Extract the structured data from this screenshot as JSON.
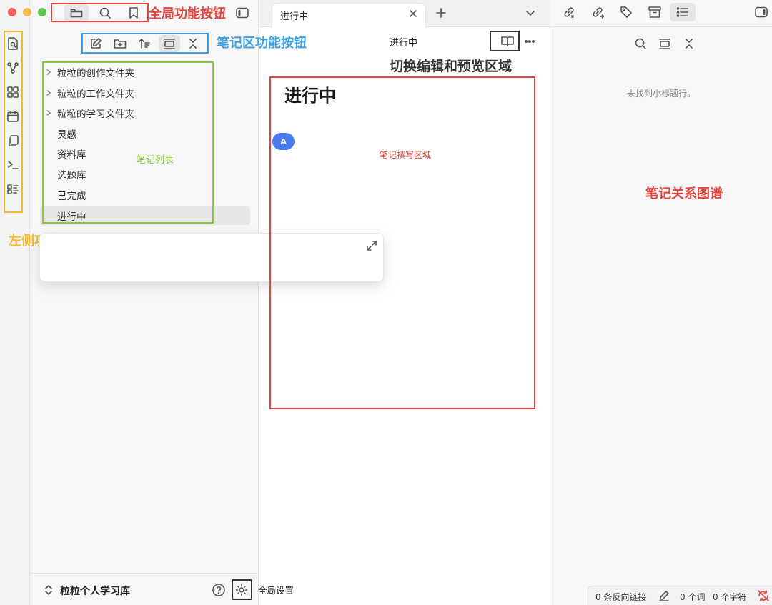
{
  "colors": {
    "annotation_red": "#e0463f",
    "annotation_blue": "#3fa1e8",
    "annotation_green": "#8cc63f",
    "annotation_yellow": "#f3b929",
    "annotation_black": "#333333",
    "avatar_blue": "#4a7cf0"
  },
  "window": {
    "traffic_lights": [
      "close",
      "minimize",
      "zoom"
    ]
  },
  "global_toolbar": {
    "icons": [
      "folder-icon",
      "search-icon",
      "bookmark-icon"
    ]
  },
  "notes_toolbar": {
    "icons": [
      "new-note-icon",
      "new-folder-icon",
      "sort-icon",
      "collapse-all-icon",
      "close-icon"
    ]
  },
  "left_rail": {
    "icons": [
      "quick-switch-icon",
      "graph-icon",
      "canvas-icon",
      "daily-note-icon",
      "templates-icon",
      "command-palette-icon",
      "outline-icon"
    ]
  },
  "file_tree": {
    "items": [
      {
        "label": "粒粒的创作文件夹",
        "folder": true
      },
      {
        "label": "粒粒的工作文件夹",
        "folder": true
      },
      {
        "label": "粒粒的学习文件夹",
        "folder": true
      },
      {
        "label": "灵感",
        "folder": false
      },
      {
        "label": "资料库",
        "folder": false
      },
      {
        "label": "选题库",
        "folder": false
      },
      {
        "label": "已完成",
        "folder": false
      },
      {
        "label": "进行中",
        "folder": false,
        "active": true
      }
    ]
  },
  "vault": {
    "name": "粒粒个人学习库"
  },
  "tabs": [
    {
      "label": "进行中",
      "active": true
    }
  ],
  "editor": {
    "breadcrumb": "进行中",
    "note_title": "进行中",
    "avatar_letter": "A"
  },
  "right_panel": {
    "empty_message": "未找到小标题行。"
  },
  "status_bar": {
    "backlinks": "0 条反向链接",
    "words": "0 个词",
    "chars": "0 个字符"
  },
  "annotations": {
    "global_buttons": "全局功能按钮",
    "notes_area_buttons": "笔记区功能按钮",
    "toggle_edit_preview": "切换编辑和预览区域",
    "note_list": "笔记列表",
    "left_buttons": "左侧功能按钮",
    "writing_area": "笔记撰写区域",
    "note_graph": "笔记关系图谱",
    "global_settings": "全局设置"
  }
}
